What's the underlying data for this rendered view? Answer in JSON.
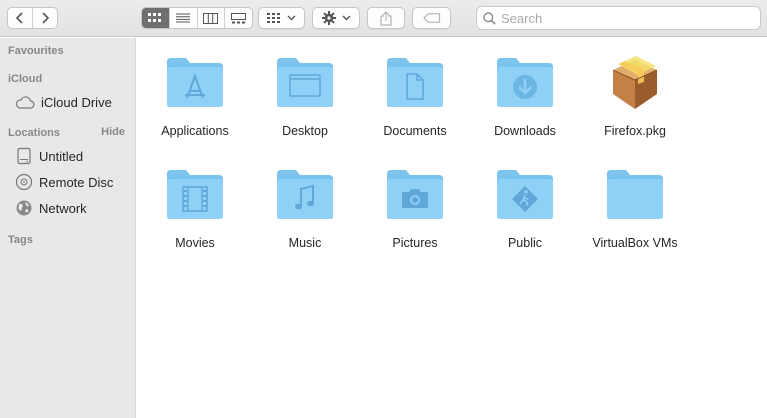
{
  "toolbar": {
    "back_icon": "chevron-left-icon",
    "forward_icon": "chevron-right-icon",
    "views": [
      "icon-view-icon",
      "list-view-icon",
      "column-view-icon",
      "gallery-view-icon"
    ],
    "group_icon": "group-icon",
    "action_icon": "gear-icon",
    "share_icon": "share-icon",
    "tag_icon": "tag-icon"
  },
  "search": {
    "placeholder": "Search",
    "value": ""
  },
  "sidebar": {
    "favourites_header": "Favourites",
    "icloud_header": "iCloud",
    "icloud_drive": "iCloud Drive",
    "locations_header": "Locations",
    "locations_hide": "Hide",
    "locations": [
      "Untitled",
      "Remote Disc",
      "Network"
    ],
    "tags_header": "Tags"
  },
  "items": [
    {
      "label": "Applications",
      "icon": "applications-folder-icon"
    },
    {
      "label": "Desktop",
      "icon": "desktop-folder-icon"
    },
    {
      "label": "Documents",
      "icon": "documents-folder-icon"
    },
    {
      "label": "Downloads",
      "icon": "downloads-folder-icon"
    },
    {
      "label": "Firefox.pkg",
      "icon": "package-icon"
    },
    {
      "label": "Movies",
      "icon": "movies-folder-icon"
    },
    {
      "label": "Music",
      "icon": "music-folder-icon"
    },
    {
      "label": "Pictures",
      "icon": "pictures-folder-icon"
    },
    {
      "label": "Public",
      "icon": "public-folder-icon"
    },
    {
      "label": "VirtualBox VMs",
      "icon": "folder-icon"
    }
  ],
  "colors": {
    "folder": "#8ed0f6",
    "folder_tab": "#7cc4ee",
    "folder_glyph": "#5fa8d8",
    "sidebar_bg": "#e8e8e8"
  }
}
